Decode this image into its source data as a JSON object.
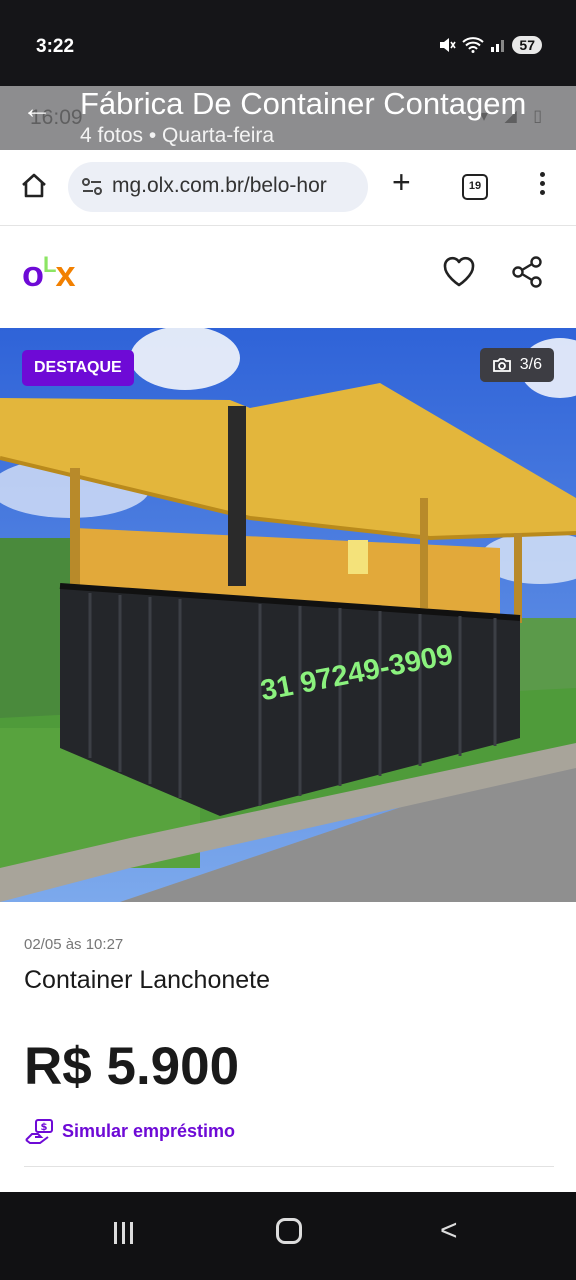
{
  "status_bar": {
    "time": "3:22",
    "battery": "57"
  },
  "viewer": {
    "back_glyph": "←",
    "title": "Fábrica De Container Contagem",
    "subtitle": "4 fotos  •  Quarta-feira",
    "ghost_time": "16:09"
  },
  "browser": {
    "url": "mg.olx.com.br/belo-hor",
    "tab_count": "19",
    "new_tab_glyph": "+"
  },
  "olx": {
    "logo": {
      "o": "o",
      "l": "L",
      "x": "x"
    },
    "brand_purple": "#6e0ad6",
    "brand_orange": "#f28000",
    "brand_green": "#8ce563"
  },
  "photo": {
    "badge": "DESTAQUE",
    "counter": "3/6",
    "overlay_phone": "31 97249-3909"
  },
  "listing": {
    "date": "02/05 às 10:27",
    "title": "Container Lanchonete",
    "price": "R$ 5.900",
    "loan_link": "Simular empréstimo"
  },
  "nav": {
    "back_glyph": "<"
  }
}
